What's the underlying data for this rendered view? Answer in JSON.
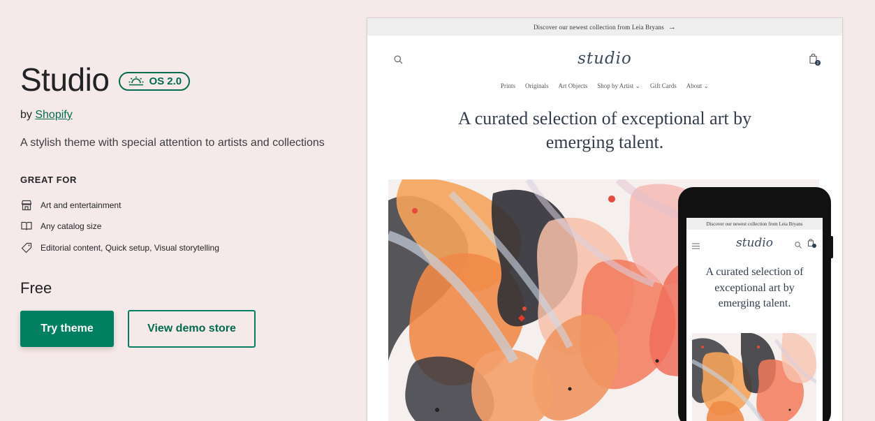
{
  "theme": {
    "name": "Studio",
    "os_badge": "OS 2.0",
    "by_prefix": "by",
    "author": "Shopify",
    "description": "A stylish theme with special attention to artists and collections",
    "great_for_heading": "GREAT FOR",
    "features": [
      {
        "icon": "storefront-icon",
        "label": "Art and entertainment"
      },
      {
        "icon": "catalog-book-icon",
        "label": "Any catalog size"
      },
      {
        "icon": "tag-icon",
        "label": "Editorial content, Quick setup, Visual storytelling"
      }
    ],
    "price": "Free",
    "try_button": "Try theme",
    "demo_button": "View demo store"
  },
  "desktop_preview": {
    "announcement": "Discover our newest collection from Leia Bryans",
    "announcement_arrow": "→",
    "logo": "studio",
    "nav": [
      {
        "label": "Prints",
        "dropdown": false
      },
      {
        "label": "Originals",
        "dropdown": false
      },
      {
        "label": "Art Objects",
        "dropdown": false
      },
      {
        "label": "Shop by Artist",
        "dropdown": true
      },
      {
        "label": "Gift Cards",
        "dropdown": false
      },
      {
        "label": "About",
        "dropdown": true
      }
    ],
    "hero_text": "A curated selection of exceptional art by emerging talent."
  },
  "mobile_preview": {
    "announcement": "Discover our newest collection from Leia Bryans",
    "logo": "studio",
    "hero_text": "A curated selection of exceptional art by emerging talent."
  },
  "colors": {
    "page_bg": "#f6e9e9",
    "brand_green": "#008060",
    "brand_green_dark": "#006b4e",
    "text": "#212326"
  }
}
